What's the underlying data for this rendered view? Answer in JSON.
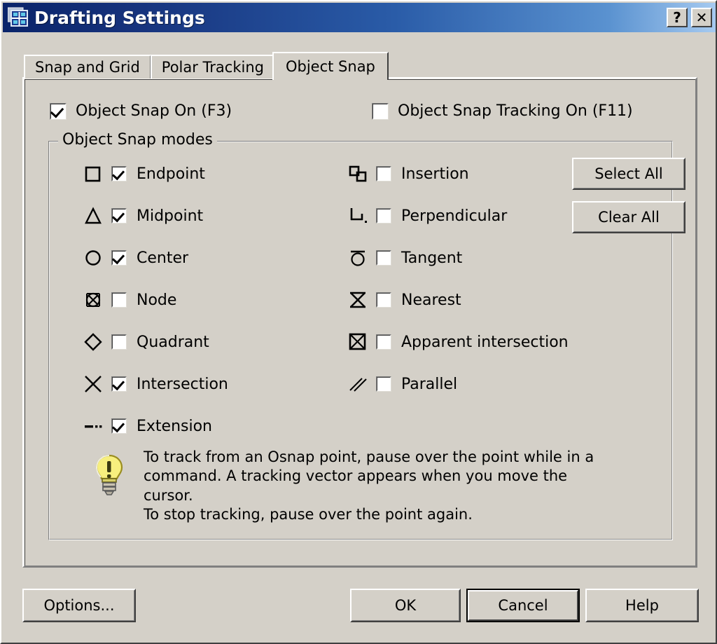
{
  "window": {
    "title": "Drafting Settings",
    "icon": "drafting-settings-icon",
    "help_button": "?",
    "close_button": "✕"
  },
  "tabs": [
    {
      "label": "Snap and Grid",
      "active": false
    },
    {
      "label": "Polar Tracking",
      "active": false
    },
    {
      "label": "Object Snap",
      "active": true
    }
  ],
  "top_checkboxes": [
    {
      "label": "Object Snap On (F3)",
      "checked": true
    },
    {
      "label": "Object Snap Tracking On (F11)",
      "checked": false
    }
  ],
  "group": {
    "title": "Object Snap modes",
    "left_column": [
      {
        "label": "Endpoint",
        "checked": true,
        "icon": "square-icon"
      },
      {
        "label": "Midpoint",
        "checked": true,
        "icon": "triangle-icon"
      },
      {
        "label": "Center",
        "checked": true,
        "icon": "circle-icon"
      },
      {
        "label": "Node",
        "checked": false,
        "icon": "node-circle-x-icon"
      },
      {
        "label": "Quadrant",
        "checked": false,
        "icon": "diamond-icon"
      },
      {
        "label": "Intersection",
        "checked": true,
        "icon": "x-cross-icon"
      },
      {
        "label": "Extension",
        "checked": true,
        "icon": "dash-dot-icon"
      }
    ],
    "right_column": [
      {
        "label": "Insertion",
        "checked": false,
        "icon": "insertion-blocks-icon"
      },
      {
        "label": "Perpendicular",
        "checked": false,
        "icon": "perpendicular-icon"
      },
      {
        "label": "Tangent",
        "checked": false,
        "icon": "tangent-circle-icon"
      },
      {
        "label": "Nearest",
        "checked": false,
        "icon": "nearest-hourglass-icon"
      },
      {
        "label": "Apparent intersection",
        "checked": false,
        "icon": "apparent-intersection-icon"
      },
      {
        "label": "Parallel",
        "checked": false,
        "icon": "parallel-lines-icon"
      }
    ],
    "select_all_label": "Select All",
    "clear_all_label": "Clear All"
  },
  "tip": {
    "icon": "lightbulb-icon",
    "text": "To track from an Osnap point, pause over the point while in a\ncommand.  A tracking vector appears when you move the cursor.\nTo stop tracking, pause over the point again."
  },
  "footer": {
    "options_label": "Options...",
    "ok_label": "OK",
    "cancel_label": "Cancel",
    "help_label": "Help",
    "default_button": "Cancel"
  },
  "colors": {
    "dialog_face": "#d4d0c8",
    "title_gradient_start": "#0a246a",
    "title_gradient_end": "#a6caf0",
    "title_text": "#ffffff",
    "shadow": "#808080",
    "dark_shadow": "#404040",
    "highlight": "#ffffff",
    "bulb_yellow": "#f5e85c"
  }
}
